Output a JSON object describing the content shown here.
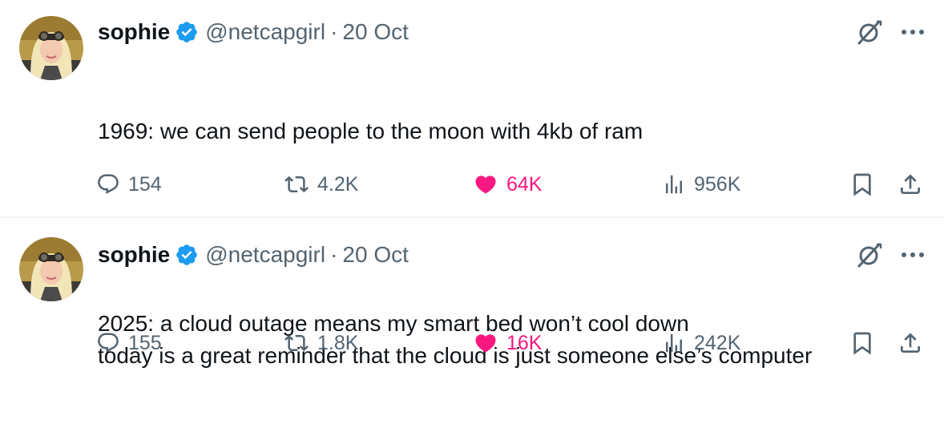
{
  "tweets": [
    {
      "author": {
        "display_name": "sophie",
        "handle": "@netcapgirl",
        "verified_icon": "verified-badge-icon",
        "avatar": "user-avatar"
      },
      "separator": "·",
      "date": "20 Oct",
      "body": [
        "1969: we can send people to the moon with 4kb of ram",
        "",
        "2025: a cloud outage means my smart bed won’t cool down"
      ],
      "stats": {
        "replies": "154",
        "reposts": "4.2K",
        "likes": "64K",
        "views": "956K"
      },
      "liked": true
    },
    {
      "author": {
        "display_name": "sophie",
        "handle": "@netcapgirl",
        "verified_icon": "verified-badge-icon",
        "avatar": "user-avatar"
      },
      "separator": "·",
      "date": "20 Oct",
      "body": [
        "today is a great reminder that the cloud is just someone else’s computer"
      ],
      "stats": {
        "replies": "155",
        "reposts": "1.8K",
        "likes": "16K",
        "views": "242K"
      },
      "liked": true
    }
  ],
  "colors": {
    "text_primary": "#0f1419",
    "text_secondary": "#536471",
    "like_pink": "#f91880",
    "verified_blue": "#1d9bf0",
    "divider": "#eff3f4"
  },
  "icons": {
    "reply": "reply-bubble-icon",
    "repost": "repost-arrows-icon",
    "like": "heart-icon",
    "views": "views-bar-chart-icon",
    "bookmark": "bookmark-icon",
    "share": "share-upload-icon",
    "grok": "grok-slash-icon",
    "more": "more-dots-icon"
  }
}
